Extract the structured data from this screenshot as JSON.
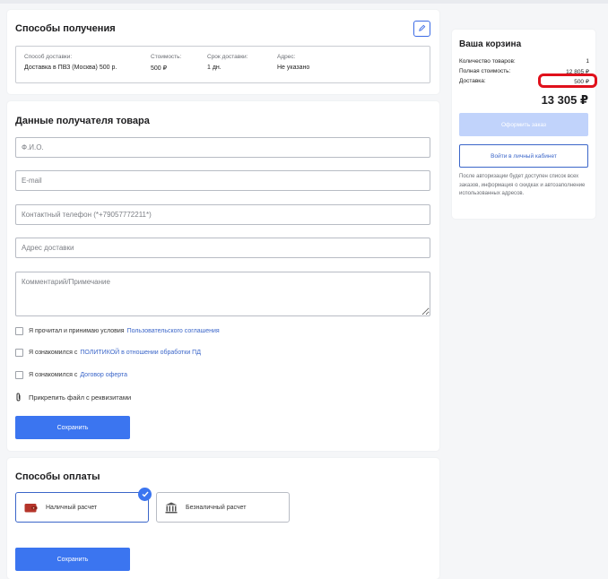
{
  "delivery": {
    "title": "Способы получения",
    "columns": [
      {
        "label": "Способ доставки:",
        "value": "Доставка в ПВЗ (Москва) 500 р."
      },
      {
        "label": "Стоимость:",
        "value": "500 ₽"
      },
      {
        "label": "Срок доставки:",
        "value": "1 дн."
      },
      {
        "label": "Адрес:",
        "value": "Не указано"
      }
    ],
    "edit_icon": "pencil-icon"
  },
  "recipient": {
    "title": "Данные получателя товара",
    "fields": {
      "name_placeholder": "Ф.И.О.",
      "email_placeholder": "E-mail",
      "phone_placeholder": "Контактный телефон (*+79057772211*)",
      "address_placeholder": "Адрес доставки",
      "comment_placeholder": "Комментарий/Примечание"
    },
    "checkboxes": [
      {
        "text": "Я прочитал и принимаю условия",
        "link": "Пользовательского соглашения"
      },
      {
        "text": "Я ознакомился с",
        "link": "ПОЛИТИКОЙ в отношении обработки ПД"
      },
      {
        "text": "Я ознакомился с",
        "link": "Договор оферта"
      }
    ],
    "attach_label": "Прикрепить файл с реквизитами",
    "attach_icon": "paperclip-icon",
    "save_label": "Сохранить"
  },
  "payment": {
    "title": "Способы оплаты",
    "options": [
      {
        "label": "Наличный расчет",
        "icon": "wallet-icon",
        "selected": true
      },
      {
        "label": "Безналичный расчет",
        "icon": "bank-icon",
        "selected": false
      }
    ],
    "save_label": "Сохранить"
  },
  "cart": {
    "title": "Ваша корзина",
    "rows": [
      {
        "label": "Количество товаров:",
        "value": "1"
      },
      {
        "label": "Полная стоимость:",
        "value": "12 805 ₽"
      },
      {
        "label": "Доставка:",
        "value": "500 ₽"
      }
    ],
    "total": "13 305 ₽",
    "checkout_label": "Оформить заказ",
    "login_label": "Войти в личный кабинет",
    "note": "После авторизации будет доступен список всех заказов, информация о скидках и автозаполнение использованных адресов."
  },
  "colors": {
    "accent": "#3b75f0",
    "link": "#3b66c9",
    "disabled": "#c1d3fb",
    "highlight": "#e0101b"
  }
}
